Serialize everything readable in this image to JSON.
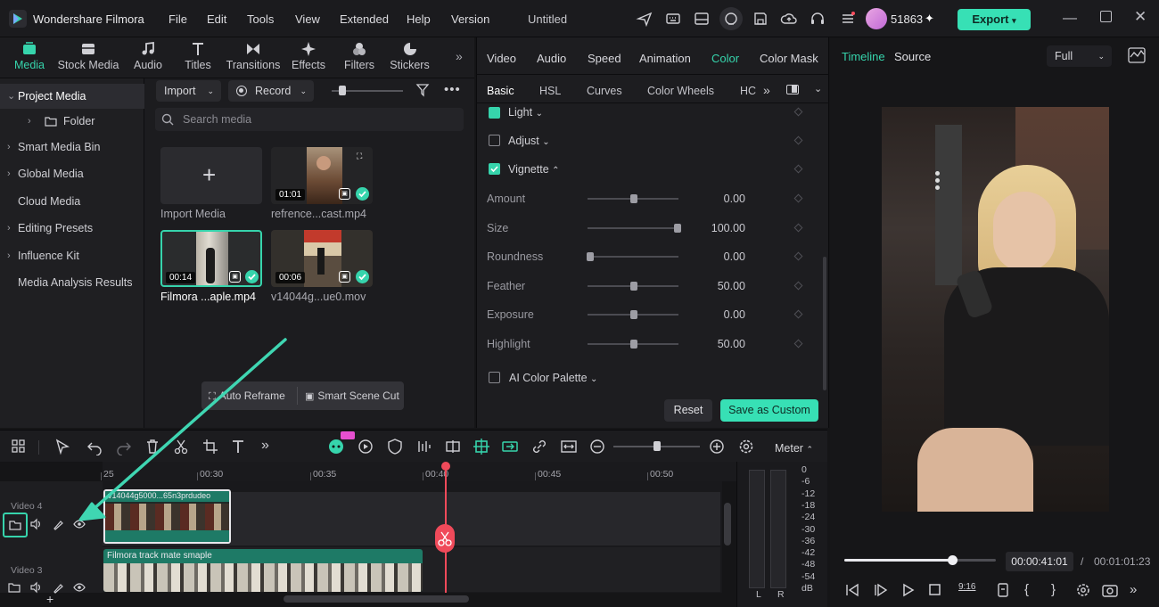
{
  "app": {
    "name": "Wondershare Filmora",
    "project_title": "Untitled",
    "credits": "51863",
    "export_label": "Export"
  },
  "menu": [
    "File",
    "Edit",
    "Tools",
    "View",
    "Extended",
    "Help",
    "Version"
  ],
  "media_tabs": [
    {
      "label": "Media",
      "icon": "media-icon"
    },
    {
      "label": "Stock Media",
      "icon": "stock-media-icon"
    },
    {
      "label": "Audio",
      "icon": "music-note-icon"
    },
    {
      "label": "Titles",
      "icon": "titles-icon"
    },
    {
      "label": "Transitions",
      "icon": "transitions-icon"
    },
    {
      "label": "Effects",
      "icon": "effects-icon"
    },
    {
      "label": "Filters",
      "icon": "filters-icon"
    },
    {
      "label": "Stickers",
      "icon": "stickers-icon"
    }
  ],
  "sidebar": {
    "items": [
      "Project Media",
      "Folder",
      "Smart Media Bin",
      "Global Media",
      "Cloud Media",
      "Editing Presets",
      "Influence Kit",
      "Media Analysis Results"
    ]
  },
  "media_toolbar": {
    "import_label": "Import",
    "record_label": "Record",
    "search_placeholder": "Search media"
  },
  "media_items": [
    {
      "label": "Import Media"
    },
    {
      "label": "refrence...cast.mp4",
      "duration": "01:01"
    },
    {
      "label": "Filmora ...aple.mp4",
      "duration": "00:14"
    },
    {
      "label": "v14044g...ue0.mov",
      "duration": "00:06"
    }
  ],
  "float_bar": {
    "auto_reframe": "Auto Reframe",
    "smart_scene_cut": "Smart Scene Cut"
  },
  "property_tabs": [
    "Video",
    "Audio",
    "Speed",
    "Animation",
    "Color",
    "Color Mask"
  ],
  "color_subtabs": [
    "Basic",
    "HSL",
    "Curves",
    "Color Wheels",
    "HC"
  ],
  "color_sections": {
    "light": "Light",
    "adjust": "Adjust",
    "vignette": "Vignette",
    "ai_palette": "AI Color Palette"
  },
  "vignette_params": [
    {
      "name": "Amount",
      "value": "0.00",
      "level": 0.5
    },
    {
      "name": "Size",
      "value": "100.00",
      "level": 1.0
    },
    {
      "name": "Roundness",
      "value": "0.00",
      "level": 0.0
    },
    {
      "name": "Feather",
      "value": "50.00",
      "level": 0.5
    },
    {
      "name": "Exposure",
      "value": "0.00",
      "level": 0.5
    },
    {
      "name": "Highlight",
      "value": "50.00",
      "level": 0.5
    }
  ],
  "panel_buttons": {
    "reset": "Reset",
    "save_custom": "Save as Custom"
  },
  "preview": {
    "tab_timeline": "Timeline",
    "tab_source": "Source",
    "quality": "Full",
    "current_time": "00:00:41:01",
    "total_time": "00:01:01:23",
    "separator": "/",
    "progress": 0.71
  },
  "timeline": {
    "ruler_labels": [
      "25",
      "00:30",
      "00:35",
      "00:40",
      "00:45",
      "00:50"
    ],
    "tracks": [
      {
        "name": "Video 4",
        "clip": "v14044g5000...65n3prdudeo"
      },
      {
        "name": "Video 3",
        "clip": "Filmora track mate smaple"
      }
    ],
    "meter_label": "Meter",
    "meter_scale": [
      "0",
      "-6",
      "-12",
      "-18",
      "-24",
      "-30",
      "-36",
      "-42",
      "-48",
      "-54",
      "dB"
    ],
    "channels": [
      "L",
      "R"
    ]
  }
}
